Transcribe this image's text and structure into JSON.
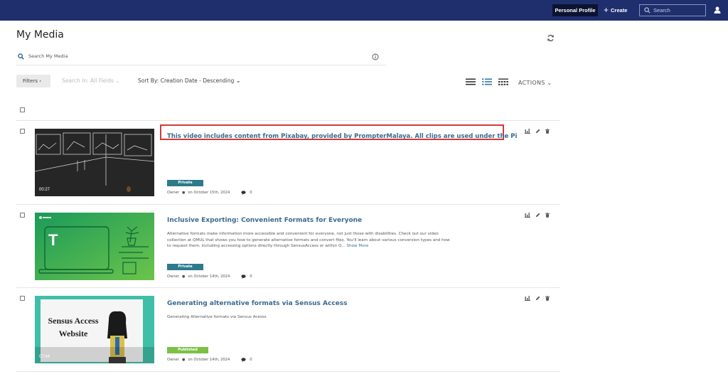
{
  "topbar": {
    "profile_label": "Personal Profile",
    "create_label": "Create",
    "search_placeholder": "Search"
  },
  "page": {
    "title": "My Media",
    "search_placeholder": "Search My Media"
  },
  "toolbar": {
    "filters_label": "Filters",
    "search_in_label": "Search In: All Fields",
    "sort_by_label": "Sort By: Creation Date - Descending",
    "actions_label": "ACTIONS"
  },
  "colors": {
    "topbar": "#1f2f6e",
    "title_link": "#3a6a8f",
    "private_badge": "#2c7a8c",
    "published_badge": "#7bc143",
    "highlight": "#d23a3a"
  },
  "media": [
    {
      "title": "This video includes content from Pixabay, provided by PrompterMalaya. All clips are used under the Pi",
      "description": "",
      "show_more": "",
      "duration": "00:27",
      "status": "Private",
      "owner": "Owner",
      "date": "on October 15th, 2024",
      "comments": "0"
    },
    {
      "title": "Inclusive Exporting: Convenient Formats for Everyone",
      "description": "Alternative formats make information more accessible and convenient for everyone, not just those with disabilities. Check out our video collection at QMUL that shows you how to generate alternative formats and convert files. You'll learn about various conversion types and how to request them, including accessing options directly through SensusAccess or within Q...",
      "show_more": "Show More",
      "duration": "",
      "status": "Private",
      "owner": "Owner",
      "date": "on October 14th, 2024",
      "comments": "0",
      "thumb_text": "T"
    },
    {
      "title": "Generating alternative formats via Sensus Access",
      "description": "Generating Alternative formats via Sensus Acesss",
      "show_more": "",
      "duration": "07:44",
      "status": "Published",
      "owner": "Owner",
      "date": "on October 14th, 2024",
      "comments": "0",
      "thumb_text_line1": "Sensus Access",
      "thumb_text_line2": "Website"
    }
  ]
}
